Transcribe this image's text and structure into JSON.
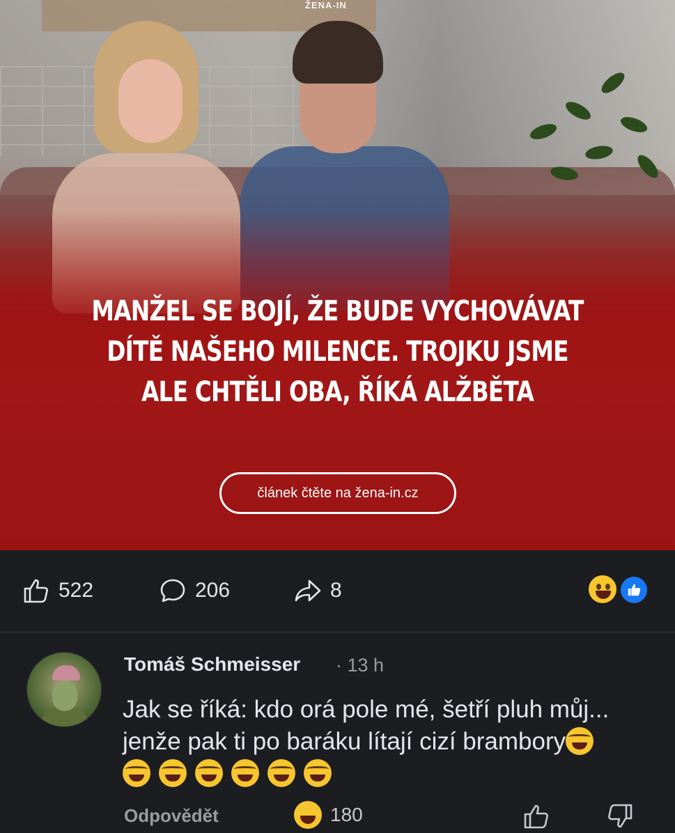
{
  "post_image": {
    "brand": "ŽENA-IN",
    "headline": "MANŽEL SE BOJÍ, ŽE BUDE VYCHOVÁVAT DÍTĚ NAŠEHO MILENCE. TROJKU JSME ALE CHTĚLI OBA, ŘÍKÁ ALŽBĚTA",
    "cta_label": "článek čtěte na žena-in.cz"
  },
  "actions": {
    "likes": "522",
    "comments": "206",
    "shares": "8",
    "reaction_icons": [
      "laughing-emoji-icon",
      "like-reaction-icon"
    ]
  },
  "comment": {
    "author": "Tomáš Schmeisser",
    "time": "13 h",
    "text": "Jak se říká: kdo orá pole mé, šetří pluh můj... jenže pak ti po baráku lítají cizí brambory",
    "trailing_emojis": 7,
    "reply_label": "Odpovědět",
    "reaction_count": "180"
  },
  "colors": {
    "background": "#1c1d20",
    "banner_red": "#a01414",
    "text_primary": "#e4e6eb",
    "text_secondary": "#9a9ca1",
    "like_blue": "#1877f2",
    "emoji_yellow": "#f7c52e"
  }
}
